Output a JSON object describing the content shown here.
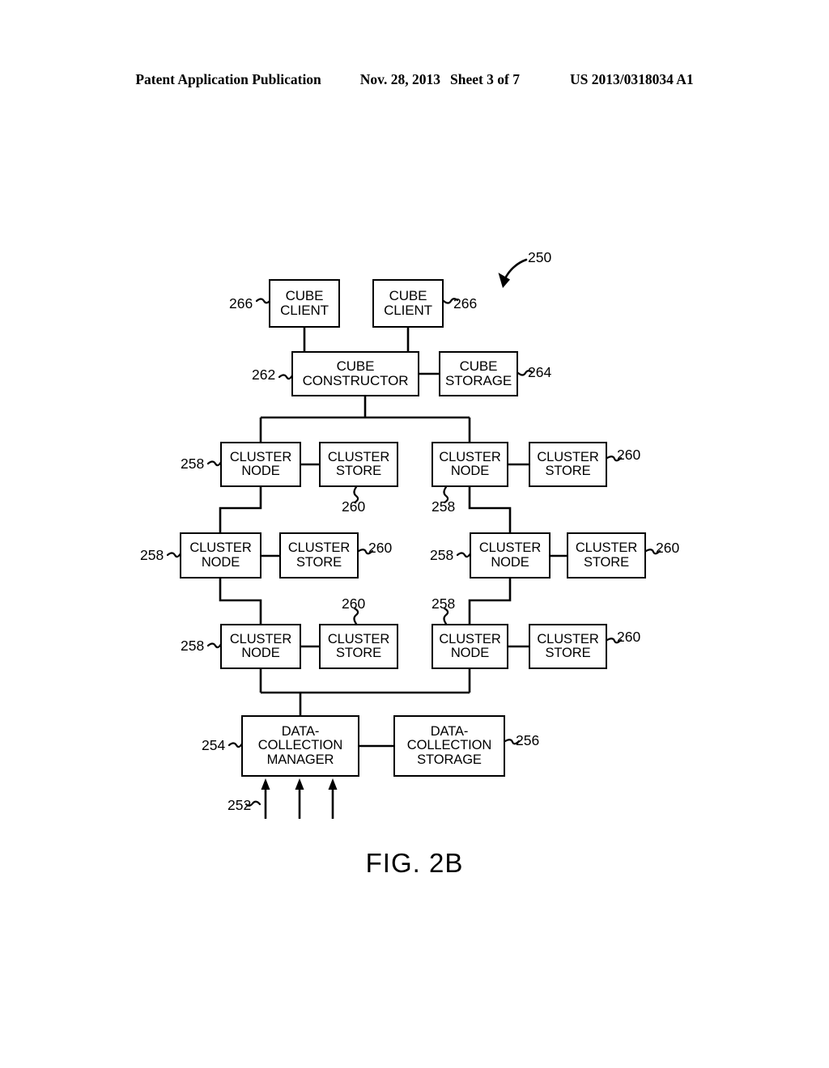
{
  "header": {
    "publication": "Patent Application Publication",
    "date": "Nov. 28, 2013",
    "sheet": "Sheet 3 of 7",
    "patent_number": "US 2013/0318034 A1"
  },
  "figure": {
    "caption": "FIG. 2B",
    "system_ref": "250"
  },
  "blocks": {
    "cube_client_left": {
      "line1": "CUBE",
      "line2": "CLIENT",
      "ref": "266"
    },
    "cube_client_right": {
      "line1": "CUBE",
      "line2": "CLIENT",
      "ref": "266"
    },
    "cube_constructor": {
      "line1": "CUBE",
      "line2": "CONSTRUCTOR",
      "ref": "262"
    },
    "cube_storage": {
      "line1": "CUBE",
      "line2": "STORAGE",
      "ref": "264"
    },
    "dc_manager": {
      "line1": "DATA-",
      "line2": "COLLECTION",
      "line3": "MANAGER",
      "ref": "254"
    },
    "dc_storage": {
      "line1": "DATA-",
      "line2": "COLLECTION",
      "line3": "STORAGE",
      "ref": "256"
    },
    "data_sources": {
      "ref": "252"
    }
  },
  "cluster_rows": [
    {
      "left_node": {
        "line1": "CLUSTER",
        "line2": "NODE",
        "ref": "258"
      },
      "left_store": {
        "line1": "CLUSTER",
        "line2": "STORE",
        "ref": "260"
      },
      "right_node": {
        "line1": "CLUSTER",
        "line2": "NODE",
        "ref": "258"
      },
      "right_store": {
        "line1": "CLUSTER",
        "line2": "STORE",
        "ref": "260"
      }
    },
    {
      "left_node": {
        "line1": "CLUSTER",
        "line2": "NODE",
        "ref": "258"
      },
      "left_store": {
        "line1": "CLUSTER",
        "line2": "STORE",
        "ref": "260"
      },
      "right_node": {
        "line1": "CLUSTER",
        "line2": "NODE",
        "ref": "258"
      },
      "right_store": {
        "line1": "CLUSTER",
        "line2": "STORE",
        "ref": "260"
      }
    },
    {
      "left_node": {
        "line1": "CLUSTER",
        "line2": "NODE",
        "ref": "258"
      },
      "left_store": {
        "line1": "CLUSTER",
        "line2": "STORE",
        "ref": "260"
      },
      "right_node": {
        "line1": "CLUSTER",
        "line2": "NODE",
        "ref": "258"
      },
      "right_store": {
        "line1": "CLUSTER",
        "line2": "STORE",
        "ref": "260"
      }
    }
  ],
  "colors": {
    "ink": "#000000",
    "paper": "#ffffff"
  }
}
